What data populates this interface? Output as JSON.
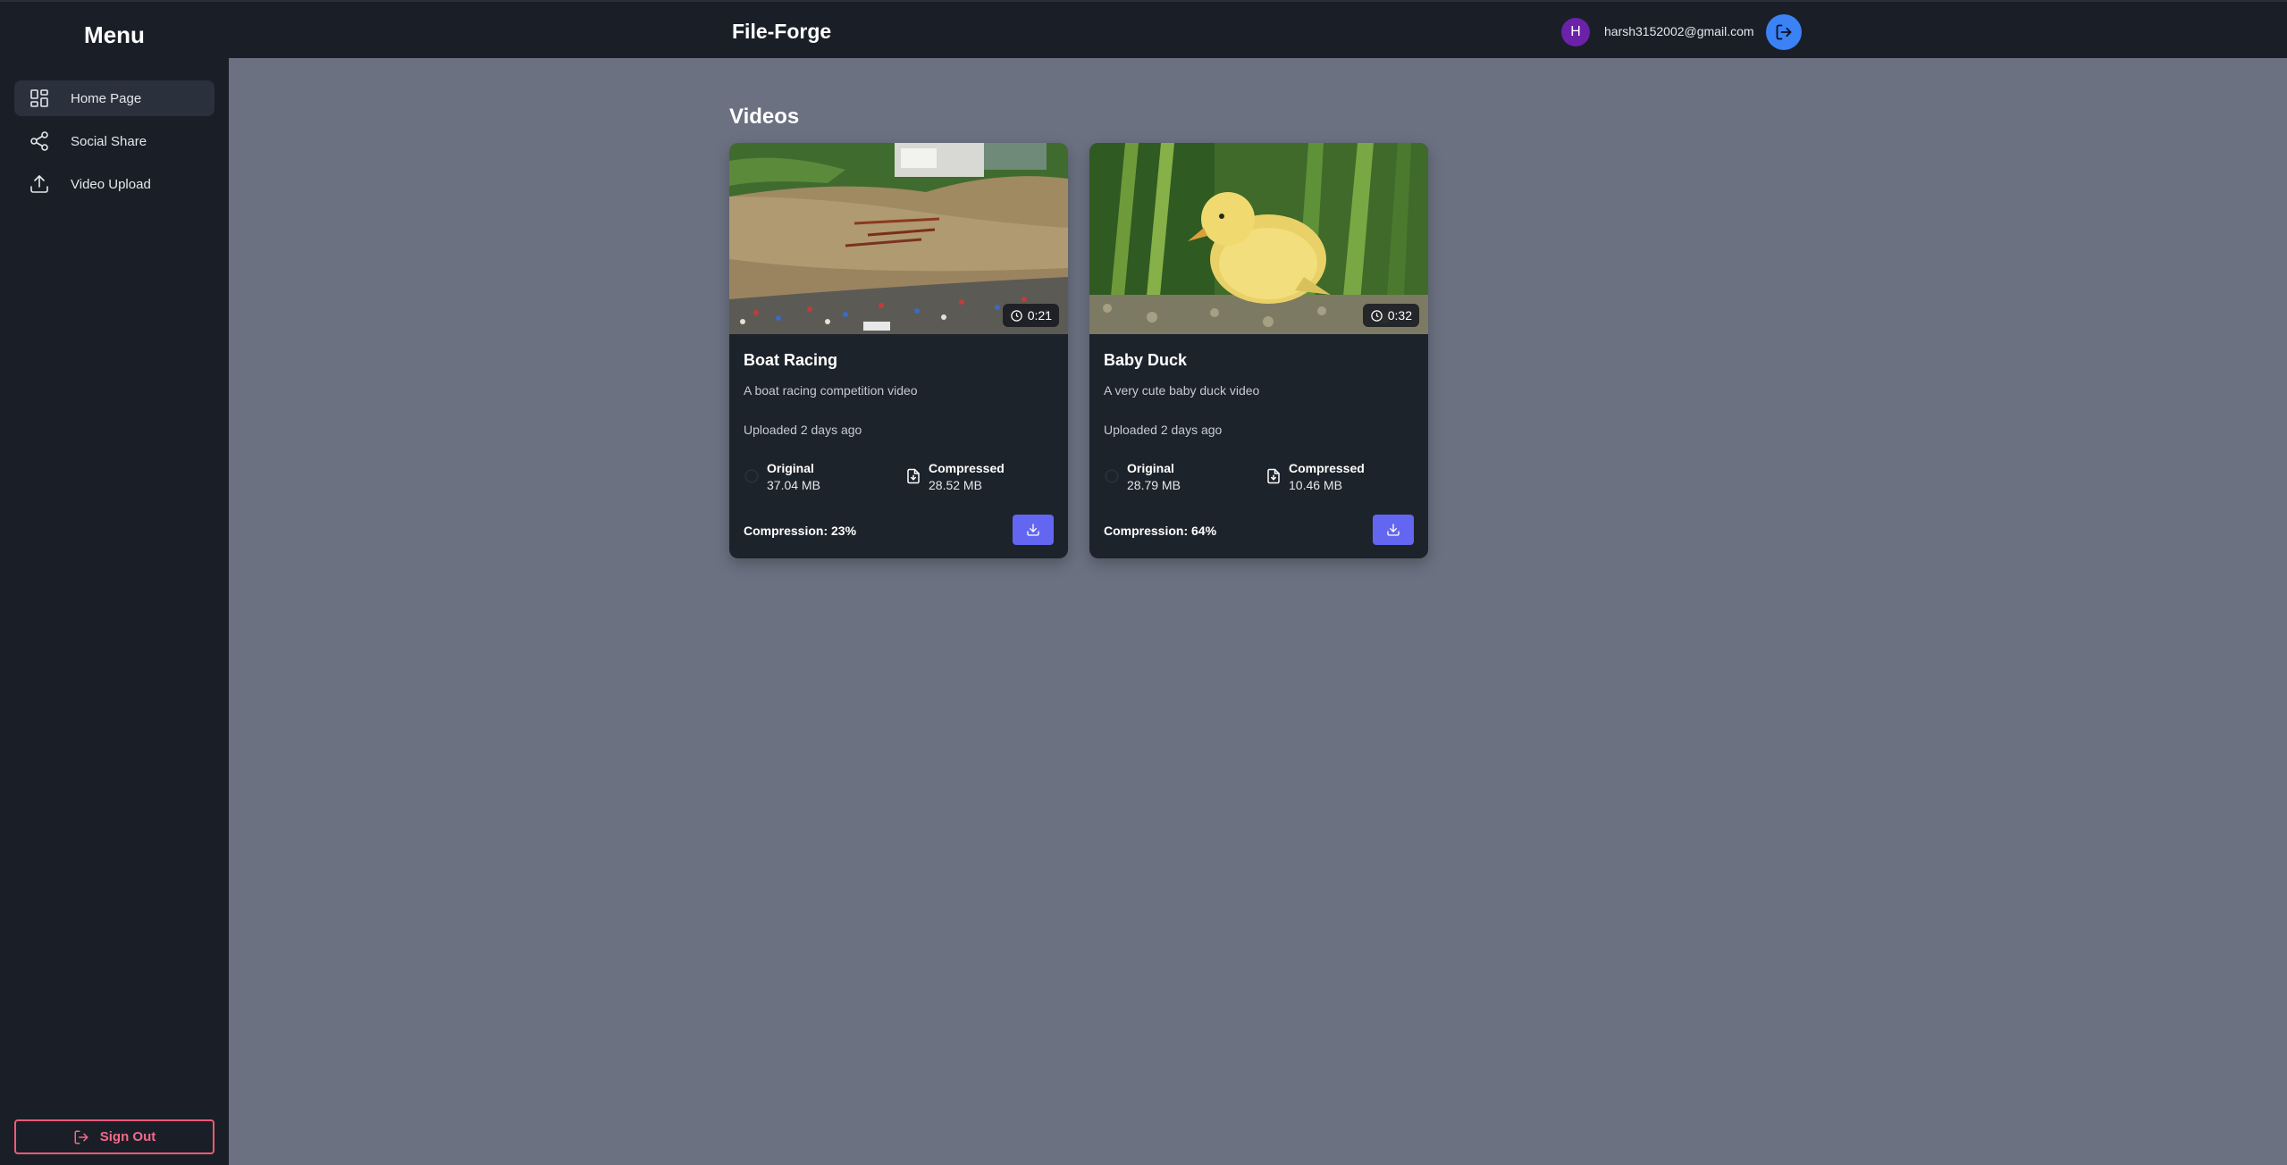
{
  "sidebar": {
    "title": "Menu",
    "items": [
      {
        "label": "Home Page",
        "icon": "grid-icon",
        "active": true
      },
      {
        "label": "Social Share",
        "icon": "share-icon",
        "active": false
      },
      {
        "label": "Video Upload",
        "icon": "upload-icon",
        "active": false
      }
    ],
    "sign_out_label": "Sign Out"
  },
  "header": {
    "brand": "File-Forge",
    "avatar_initial": "H",
    "email": "harsh3152002@gmail.com"
  },
  "main": {
    "section_title": "Videos",
    "videos": [
      {
        "title": "Boat Racing",
        "description": "A boat racing competition video",
        "duration": "0:21",
        "uploaded": "Uploaded 2 days ago",
        "original_label": "Original",
        "original_size": "37.04 MB",
        "compressed_label": "Compressed",
        "compressed_size": "28.52 MB",
        "compression": "Compression: 23%"
      },
      {
        "title": "Baby Duck",
        "description": "A very cute baby duck video",
        "duration": "0:32",
        "uploaded": "Uploaded 2 days ago",
        "original_label": "Original",
        "original_size": "28.79 MB",
        "compressed_label": "Compressed",
        "compressed_size": "10.46 MB",
        "compression": "Compression: 64%"
      }
    ]
  },
  "colors": {
    "page_bg": "#6b7181",
    "panel_bg": "#1a1f27",
    "card_bg": "#1d232b",
    "accent_button": "#6366f1",
    "logout_button": "#3b82f6",
    "sign_out": "#f05a78",
    "avatar": "#6b21a8"
  }
}
